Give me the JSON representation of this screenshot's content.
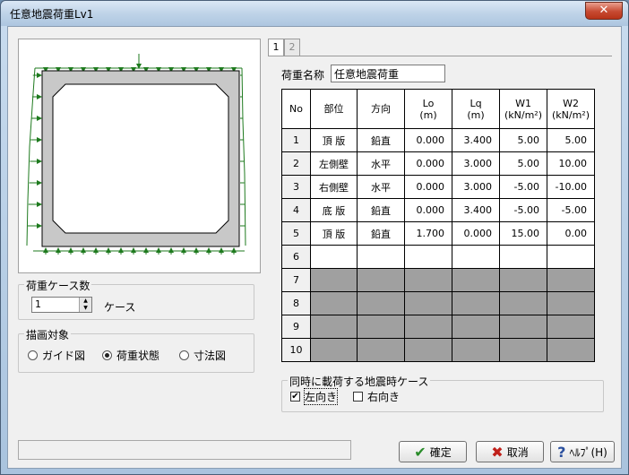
{
  "window": {
    "title": "任意地震荷重Lv1",
    "close_glyph": "✕"
  },
  "case_count": {
    "group_title": "荷重ケース数",
    "value": "1",
    "unit": "ケース"
  },
  "draw_target": {
    "group_title": "描画対象",
    "options": [
      {
        "label": "ガイド図",
        "selected": false
      },
      {
        "label": "荷重状態",
        "selected": true
      },
      {
        "label": "寸法図",
        "selected": false
      }
    ]
  },
  "tabs": [
    {
      "label": "1",
      "active": true
    },
    {
      "label": "2",
      "active": false
    }
  ],
  "load_name": {
    "label": "荷重名称",
    "value": "任意地震荷重"
  },
  "table": {
    "headers": [
      "No",
      "部位",
      "方向",
      "Lo\n(m)",
      "Lq\n(m)",
      "W1\n(kN/m²)",
      "W2\n(kN/m²)"
    ],
    "rows": [
      {
        "no": "1",
        "part": "頂 版",
        "dir": "鉛直",
        "lo": "0.000",
        "lq": "3.400",
        "w1": "5.00",
        "w2": "5.00"
      },
      {
        "no": "2",
        "part": "左側壁",
        "dir": "水平",
        "lo": "0.000",
        "lq": "3.000",
        "w1": "5.00",
        "w2": "10.00"
      },
      {
        "no": "3",
        "part": "右側壁",
        "dir": "水平",
        "lo": "0.000",
        "lq": "3.000",
        "w1": "-5.00",
        "w2": "-10.00"
      },
      {
        "no": "4",
        "part": "底 版",
        "dir": "鉛直",
        "lo": "0.000",
        "lq": "3.400",
        "w1": "-5.00",
        "w2": "-5.00"
      },
      {
        "no": "5",
        "part": "頂 版",
        "dir": "鉛直",
        "lo": "1.700",
        "lq": "0.000",
        "w1": "15.00",
        "w2": "0.00"
      }
    ],
    "empty_row_nos": [
      "6"
    ],
    "disabled_row_nos": [
      "7",
      "8",
      "9",
      "10"
    ]
  },
  "simultaneous": {
    "group_title": "同時に載荷する地震時ケース",
    "left": {
      "label": "左向き",
      "checked": true
    },
    "right": {
      "label": "右向き",
      "checked": false
    }
  },
  "buttons": {
    "ok": {
      "label": "確定",
      "icon": "check-icon"
    },
    "cancel": {
      "label": "取消",
      "icon": "cross-icon"
    },
    "help": {
      "label": "ﾍﾙﾌﾟ(H)",
      "icon": "question-icon"
    }
  }
}
